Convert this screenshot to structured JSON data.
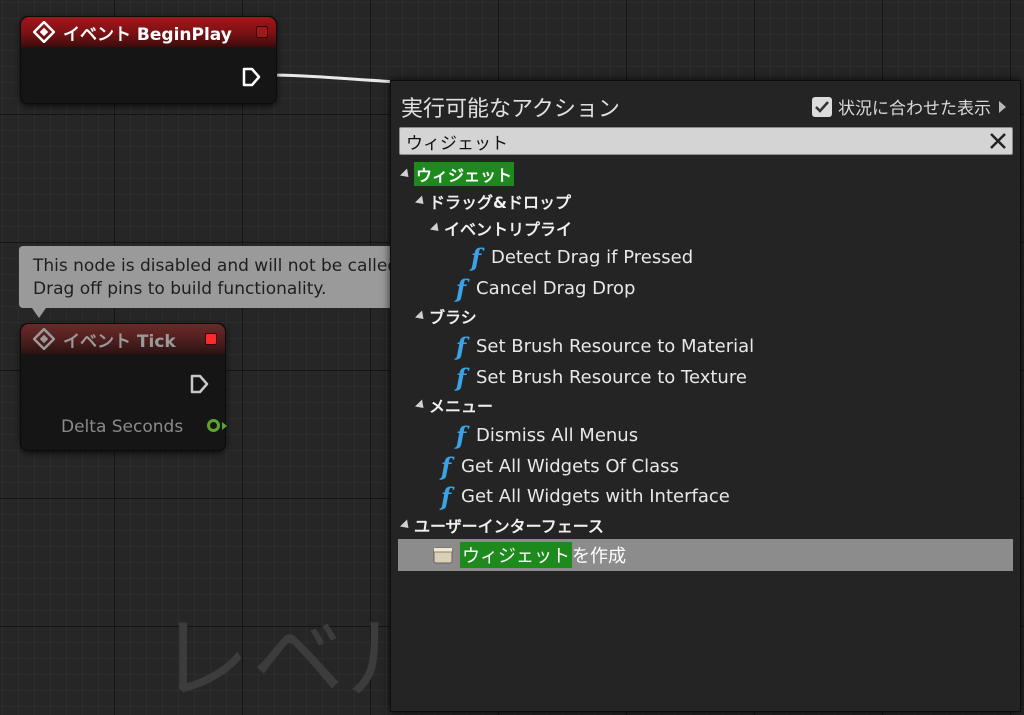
{
  "graph": {
    "watermark": "レベル",
    "begin_node": {
      "title": "イベント BeginPlay"
    },
    "tick_node": {
      "title": "イベント Tick",
      "output_label": "Delta Seconds"
    },
    "comment": {
      "line1": "This node is disabled and will not be called.",
      "line2": "Drag off pins to build functionality."
    }
  },
  "menu": {
    "title": "実行可能なアクション",
    "context_toggle_label": "状況に合わせた表示",
    "context_toggle_checked": true,
    "search_value": "ウィジェット",
    "tree": {
      "cat_widget": "ウィジェット",
      "cat_dragdrop": "ドラッグ&ドロップ",
      "cat_event_reply": "イベントリプライ",
      "fn_detect_drag": "Detect Drag if Pressed",
      "fn_cancel_drag": "Cancel Drag Drop",
      "cat_brush": "ブラシ",
      "fn_brush_material": "Set Brush Resource to Material",
      "fn_brush_texture": "Set Brush Resource to Texture",
      "cat_menu": "メニュー",
      "fn_dismiss_menus": "Dismiss All Menus",
      "fn_get_widgets_class": "Get All Widgets Of Class",
      "fn_get_widgets_interface": "Get All Widgets with Interface",
      "cat_user_interface": "ユーザーインターフェース",
      "sel_create_widget_highlight": "ウィジェット",
      "sel_create_widget_suffix": "を作成"
    }
  },
  "colors": {
    "event_header": "#a3161a",
    "function_icon": "#3aa3e8",
    "highlight": "#1e8a1e",
    "float_pin": "#5fa32d",
    "selection": "#8c8c8c"
  }
}
